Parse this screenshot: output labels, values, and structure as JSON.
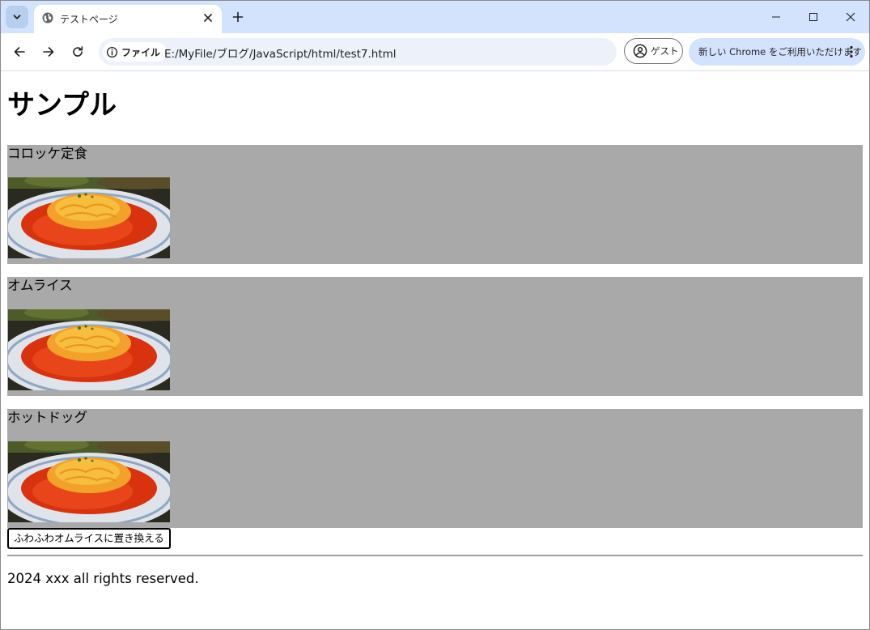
{
  "browser": {
    "tab_title": "テストページ",
    "site_info_label": "ファイル",
    "url": "E:/MyFile/ブログ/JavaScript/html/test7.html",
    "profile_label": "ゲスト",
    "promo_label": "新しい Chrome をご利用いただけます",
    "icons": {
      "tab_search": "chevron-down-icon",
      "favicon": "globe-icon",
      "tab_close": "close-icon",
      "new_tab": "plus-icon",
      "minimize": "minimize-icon",
      "maximize": "maximize-icon",
      "close_window": "close-icon",
      "back": "back-arrow-icon",
      "forward": "forward-arrow-icon",
      "reload": "reload-icon",
      "site_info": "info-icon",
      "profile": "person-icon",
      "menu": "more-vertical-icon"
    },
    "colors": {
      "tabstrip": "#d3e3fd",
      "omnibox": "#edf2fa"
    }
  },
  "page": {
    "heading": "サンプル",
    "items": [
      {
        "name": "コロッケ定食",
        "image": "omurice-photo"
      },
      {
        "name": "オムライス",
        "image": "omurice-photo"
      },
      {
        "name": "ホットドッグ",
        "image": "omurice-photo"
      }
    ],
    "button_label": "ふわふわオムライスに置き換える",
    "footer": "2024 xxx all rights reserved.",
    "colors": {
      "item_background": "#a9a9a9"
    }
  }
}
